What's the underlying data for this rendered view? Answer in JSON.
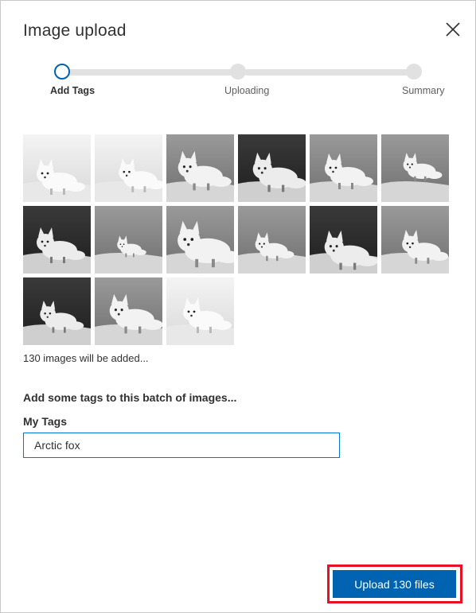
{
  "dialog": {
    "title": "Image upload",
    "close_icon": "close-icon"
  },
  "stepper": {
    "steps": [
      {
        "label": "Add Tags",
        "state": "active"
      },
      {
        "label": "Uploading",
        "state": "pending"
      },
      {
        "label": "Summary",
        "state": "pending"
      }
    ]
  },
  "thumbnails": [
    {
      "name": "arctic-fox-thumb-1",
      "tone": "light"
    },
    {
      "name": "arctic-fox-thumb-2",
      "tone": "light"
    },
    {
      "name": "arctic-fox-thumb-3",
      "tone": "mid"
    },
    {
      "name": "arctic-fox-thumb-4",
      "tone": "dark"
    },
    {
      "name": "arctic-fox-thumb-5",
      "tone": "mid"
    },
    {
      "name": "arctic-fox-thumb-6",
      "tone": "mid"
    },
    {
      "name": "arctic-fox-thumb-7",
      "tone": "dark"
    },
    {
      "name": "arctic-fox-thumb-8",
      "tone": "mid"
    },
    {
      "name": "arctic-fox-thumb-9",
      "tone": "mid"
    },
    {
      "name": "arctic-fox-thumb-10",
      "tone": "mid"
    },
    {
      "name": "arctic-fox-thumb-11",
      "tone": "dark"
    },
    {
      "name": "arctic-fox-thumb-12",
      "tone": "mid"
    },
    {
      "name": "arctic-fox-thumb-13",
      "tone": "dark"
    },
    {
      "name": "arctic-fox-thumb-14",
      "tone": "mid"
    },
    {
      "name": "arctic-fox-thumb-15",
      "tone": "light"
    }
  ],
  "batch": {
    "count_text": "130 images will be added..."
  },
  "tags": {
    "heading": "Add some tags to this batch of images...",
    "field_label": "My Tags",
    "value": "Arctic fox"
  },
  "actions": {
    "upload_label": "Upload 130 files"
  },
  "colors": {
    "accent": "#0063b1",
    "input_border": "#0078d4",
    "highlight": "#e81123",
    "track": "#e1e1e1"
  }
}
